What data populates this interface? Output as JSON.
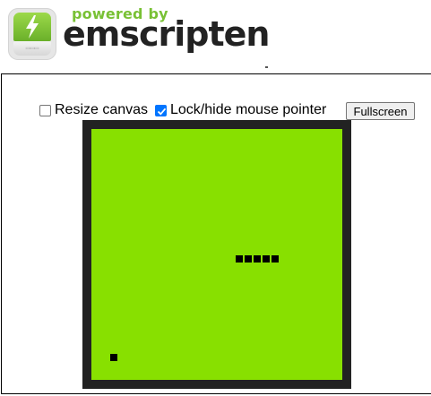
{
  "header": {
    "powered_by": "powered by",
    "brand": "emscripten",
    "colors": {
      "accent": "#79c135",
      "brand_text": "#222222"
    }
  },
  "controls": {
    "resize_canvas": {
      "label": "Resize canvas",
      "checked": false
    },
    "lock_pointer": {
      "label": "Lock/hide mouse pointer",
      "checked": true
    },
    "fullscreen_label": "Fullscreen"
  },
  "game": {
    "background_color": "#88e000",
    "border_color": "#222222",
    "snake_color": "#000000",
    "snake": [
      [
        16,
        14
      ],
      [
        17,
        14
      ],
      [
        18,
        14
      ],
      [
        19,
        14
      ],
      [
        20,
        14
      ]
    ],
    "food": [
      2,
      25
    ]
  }
}
